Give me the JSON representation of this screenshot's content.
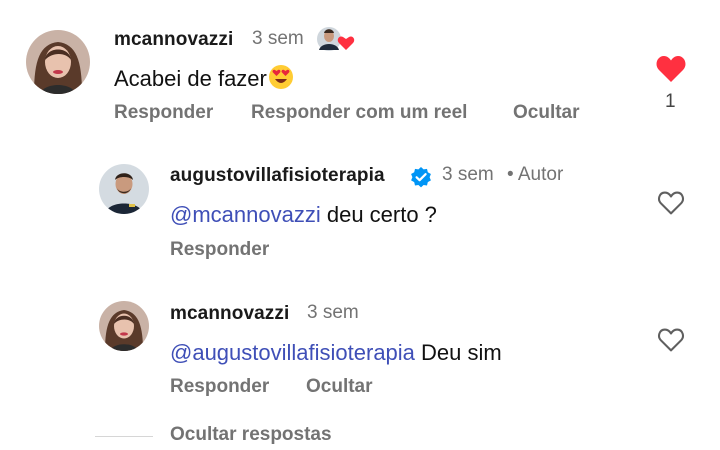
{
  "comments": [
    {
      "username": "mcannovazzi",
      "time": "3 sem",
      "text": "Acabei de fazer",
      "text_emoji": "heart-eyes",
      "creator_liked": true,
      "actions": [
        "Responder",
        "Responder com um reel",
        "Ocultar"
      ],
      "liked": true,
      "like_count": "1"
    },
    {
      "username": "augustovillafisioterapia",
      "verified": true,
      "time": "3 sem",
      "author_badge": "• Autor",
      "mention": "@mcannovazzi",
      "text": " deu certo ?",
      "actions": [
        "Responder"
      ],
      "liked": false
    },
    {
      "username": "mcannovazzi",
      "time": "3 sem",
      "mention": "@augustovillafisioterapia",
      "text": " Deu sim",
      "actions": [
        "Responder",
        "Ocultar"
      ],
      "liked": false
    }
  ],
  "hide_replies_label": "Ocultar respostas",
  "colors": {
    "like_red": "#ff3040",
    "mention_blue": "#3f4fb7",
    "muted_gray": "#737373",
    "verified_blue": "#0095f6"
  },
  "icons": [
    "heart-filled-icon",
    "heart-outline-icon",
    "verified-badge-icon",
    "heart-eyes-emoji",
    "creator-liked-badge"
  ]
}
